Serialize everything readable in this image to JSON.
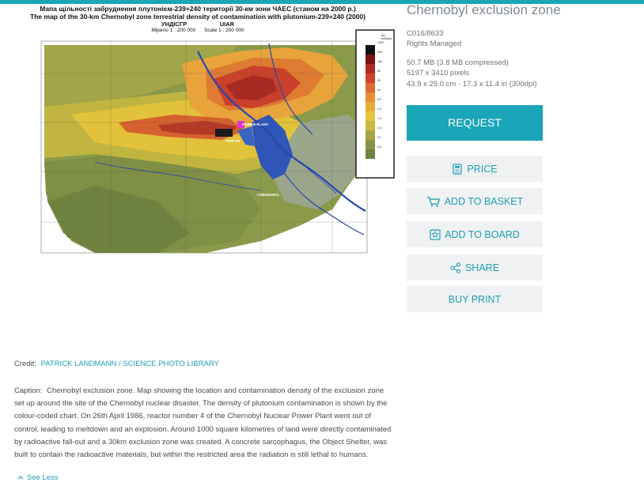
{
  "image": {
    "title_line1": "Мапа щільності забруднення плутонієм-239+240 території 30-км зони ЧАЕС (станом на 2000 р.)",
    "title_line2": "The map of the 30-km Chernobyl zone terrestrial density of contamination with plutonium-239+240 (2000)",
    "title_line3": "УНДІСГР                    UIAR",
    "title_line4": "Мірило 1 : 200 000      Scale 1 : 200 000",
    "label_power_plant": "POWER PLANT",
    "label_pripyat": "PRIPYAT",
    "label_chernobyl": "CHERNOBYL",
    "legend_unit": "Бк/м²/Bq/m²",
    "legend_values": [
      "1000",
      "500",
      "100",
      "50",
      "20",
      "10",
      "5.0",
      "2.0",
      "1.0",
      "0.4",
      "0.1",
      "0.0"
    ]
  },
  "info": {
    "title": "Chernobyl exclusion zone",
    "code": "C016/8633",
    "license": "Rights Managed",
    "file_size": "50.7 MB (3.8 MB compressed)",
    "pixels": "5197 x 3410 pixels",
    "dimensions": "43.9 x 29.0 cm · 17.3 x 11.4 in (300dpi)"
  },
  "actions": {
    "request": "REQUEST",
    "price": "PRICE",
    "add_to_basket": "ADD TO BASKET",
    "add_to_board": "ADD TO BOARD",
    "share": "SHARE",
    "buy_print": "BUY PRINT"
  },
  "credit": {
    "label": "Credit:",
    "value": "PATRICK LANDMANN / SCIENCE PHOTO LIBRARY"
  },
  "caption": {
    "label": "Caption:",
    "text": "Chernobyl exclusion zone. Map showing the location and contamination density of the exclusion zone set up around the site of the Chernobyl nuclear disaster. The density of plutonium contamination is shown by the colour-coded chart. On 26th April 1986, reactor number 4 of the Chernobyl Nuclear Power Plant went out of control, leading to meltdown and an explosion. Around 1000 square kilometres of land were directly contaminated by radioactive fall-out and a 30km exclusion zone was created. A concrete sarcophagus, the Object Shelter, was built to contain the radioactive materials, but within the restricted area the radiation is still lethal to humans.",
    "see_less": "See Less"
  },
  "colors": {
    "accent": "#1aa5b8",
    "button_bg": "#f0f1f3",
    "link": "#1ea0b4"
  }
}
